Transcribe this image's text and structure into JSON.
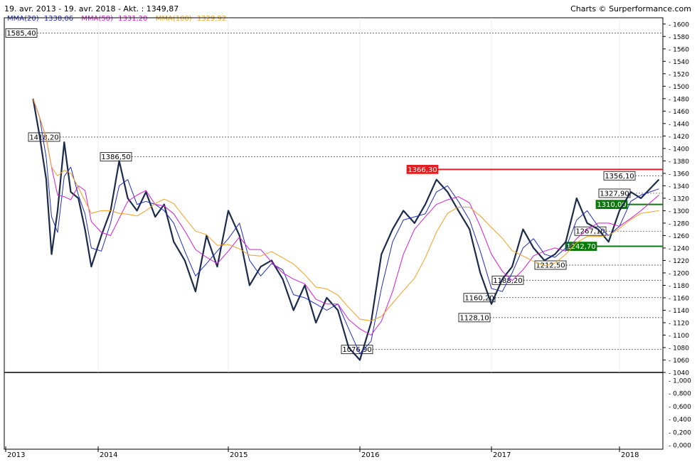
{
  "header": {
    "range_text": "19. avr. 2013 - 19. avr. 2018 - Akt. : 1349,87",
    "credit_text": "Charts © Surperformance.com"
  },
  "legend": [
    {
      "label": "MMA(20)",
      "value": "1338,06",
      "color": "#1f2bbf"
    },
    {
      "label": "MMA(50)",
      "value": "1331,20",
      "color": "#d21ed2"
    },
    {
      "label": "MMA(100)",
      "value": "1329,92",
      "color": "#f0a020"
    }
  ],
  "colors": {
    "price": "#1c2b4a",
    "resistance": "#e02020",
    "support": "#0a7a0a",
    "grid": "#444444"
  },
  "chart_data": {
    "type": "line",
    "ylim": [
      1040,
      1610
    ],
    "y_ticks": [
      1040,
      1060,
      1080,
      1100,
      1120,
      1140,
      1160,
      1180,
      1200,
      1220,
      1240,
      1260,
      1280,
      1300,
      1320,
      1340,
      1360,
      1380,
      1400,
      1420,
      1440,
      1460,
      1480,
      1500,
      1520,
      1540,
      1560,
      1580,
      1600
    ],
    "x_ticks": [
      "2013",
      "2014",
      "2015",
      "2016",
      "2017",
      "2018"
    ],
    "series": [
      {
        "name": "",
        "x": [
          "2013-04-19",
          "2013-05-15",
          "2013-06-10",
          "2013-07-01",
          "2013-07-25",
          "2013-08-20",
          "2013-09-15",
          "2013-10-15",
          "2013-11-10",
          "2013-12-05",
          "2014-01-10",
          "2014-02-05",
          "2014-03-01",
          "2014-03-25",
          "2014-04-20",
          "2014-05-15",
          "2014-06-10",
          "2014-07-05",
          "2014-08-01",
          "2014-09-01",
          "2014-10-01",
          "2014-11-01",
          "2014-12-01",
          "2015-01-01",
          "2015-02-01",
          "2015-03-01",
          "2015-04-01",
          "2015-05-01",
          "2015-06-01",
          "2015-07-01",
          "2015-08-01",
          "2015-09-01",
          "2015-10-01",
          "2015-11-01",
          "2015-12-01",
          "2016-01-01",
          "2016-02-01",
          "2016-03-01",
          "2016-04-01",
          "2016-05-01",
          "2016-06-01",
          "2016-07-01",
          "2016-08-01",
          "2016-09-01",
          "2016-10-01",
          "2016-11-01",
          "2016-12-01",
          "2017-01-01",
          "2017-02-01",
          "2017-03-01",
          "2017-04-01",
          "2017-05-01",
          "2017-06-01",
          "2017-07-01",
          "2017-08-01",
          "2017-09-01",
          "2017-10-01",
          "2017-11-01",
          "2017-12-01",
          "2018-01-01",
          "2018-02-01",
          "2018-03-01",
          "2018-04-19"
        ],
        "values": [
          1480,
          1420,
          1350,
          1230,
          1300,
          1410,
          1330,
          1320,
          1270,
          1210,
          1260,
          1300,
          1380,
          1320,
          1300,
          1330,
          1290,
          1310,
          1250,
          1220,
          1170,
          1260,
          1210,
          1300,
          1260,
          1180,
          1210,
          1220,
          1190,
          1140,
          1180,
          1120,
          1160,
          1140,
          1080,
          1060,
          1120,
          1230,
          1270,
          1300,
          1280,
          1310,
          1350,
          1330,
          1300,
          1270,
          1200,
          1150,
          1190,
          1210,
          1270,
          1240,
          1220,
          1230,
          1250,
          1320,
          1280,
          1270,
          1250,
          1300,
          1330,
          1320,
          1350
        ]
      }
    ],
    "annotations": [
      {
        "label": "1585,40",
        "y": 1585.4
      },
      {
        "label": "1418,20",
        "y": 1418.2
      },
      {
        "label": "1386,50",
        "y": 1386.5
      },
      {
        "label": "1366,30",
        "y": 1366.3
      },
      {
        "label": "1356,10",
        "y": 1356.1
      },
      {
        "label": "1327,90",
        "y": 1327.9
      },
      {
        "label": "1310,00",
        "y": 1310.0
      },
      {
        "label": "1267,10",
        "y": 1267.1
      },
      {
        "label": "1242,70",
        "y": 1242.7
      },
      {
        "label": "1212,50",
        "y": 1212.5
      },
      {
        "label": "1188,20",
        "y": 1188.2
      },
      {
        "label": "1160,20",
        "y": 1160.2
      },
      {
        "label": "1128,10",
        "y": 1128.1
      },
      {
        "label": "1076,90",
        "y": 1076.9
      }
    ],
    "sub_panel": {
      "ylim": [
        0,
        1
      ],
      "y_ticks": [
        "0,000",
        "0,200",
        "0,400",
        "0,600",
        "0,800",
        "1,000"
      ]
    }
  }
}
